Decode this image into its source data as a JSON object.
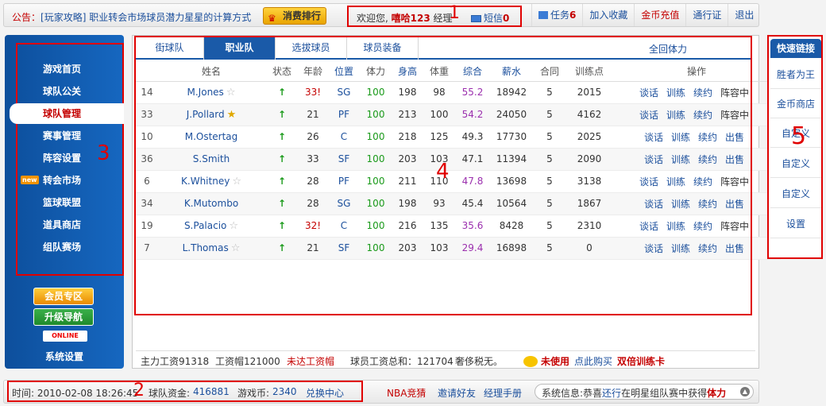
{
  "header": {
    "announce_prefix": "公告：",
    "announce_text": "[玩家攻略] 职业转会市场球员潜力星星的计算方式",
    "rank_button": "消费排行",
    "welcome_prefix": "欢迎您,",
    "username": "嘻哈123",
    "user_role": "经理",
    "mail_label": "短信",
    "mail_count": "0",
    "task_label": "任务",
    "task_count": "6",
    "favorite": "加入收藏",
    "gold_recharge": "金币充值",
    "passport": "通行证",
    "logout": "退出"
  },
  "markers": [
    "1",
    "2",
    "3",
    "4",
    "5"
  ],
  "sidebar": {
    "items": [
      {
        "label": "游戏首页"
      },
      {
        "label": "球队公关"
      },
      {
        "label": "球队管理"
      },
      {
        "label": "赛事管理"
      },
      {
        "label": "阵容设置"
      },
      {
        "label": "转会市场",
        "badge": "new"
      },
      {
        "label": "篮球联盟"
      },
      {
        "label": "道具商店"
      },
      {
        "label": "组队赛场"
      }
    ],
    "vip": "会员专区",
    "upgrade": "升级导航",
    "online": "ONLINE",
    "settings": "系统设置"
  },
  "tabs": [
    "街球队",
    "职业队",
    "选拔球员",
    "球员装备"
  ],
  "tab_right": "全回体力",
  "table": {
    "headers": [
      "姓名",
      "状态",
      "年龄",
      "位置",
      "体力",
      "身高",
      "体重",
      "综合",
      "薪水",
      "合同",
      "训练点",
      "操作"
    ],
    "rows": [
      {
        "num": "14",
        "name": "M.Jones",
        "age": "33!",
        "pos": "SG",
        "stamina": "100",
        "height": "198",
        "weight": "98",
        "overall": "55.2",
        "salary": "18942",
        "contract": "5",
        "train": "2015",
        "ops": [
          "谈话",
          "训练",
          "续约",
          "阵容中"
        ]
      },
      {
        "num": "33",
        "name": "J.Pollard",
        "age": "21",
        "pos": "PF",
        "stamina": "100",
        "height": "213",
        "weight": "100",
        "overall": "54.2",
        "salary": "24050",
        "contract": "5",
        "train": "4162",
        "ops": [
          "谈话",
          "训练",
          "续约",
          "阵容中"
        ]
      },
      {
        "num": "10",
        "name": "M.Ostertag",
        "age": "26",
        "pos": "C",
        "stamina": "100",
        "height": "218",
        "weight": "125",
        "overall": "49.3",
        "salary": "17730",
        "contract": "5",
        "train": "2025",
        "ops": [
          "谈话",
          "训练",
          "续约",
          "出售"
        ]
      },
      {
        "num": "36",
        "name": "S.Smith",
        "age": "33",
        "pos": "SF",
        "stamina": "100",
        "height": "203",
        "weight": "103",
        "overall": "47.1",
        "salary": "11394",
        "contract": "5",
        "train": "2090",
        "ops": [
          "谈话",
          "训练",
          "续约",
          "出售"
        ]
      },
      {
        "num": "6",
        "name": "K.Whitney",
        "age": "28",
        "pos": "PF",
        "stamina": "100",
        "height": "211",
        "weight": "110",
        "overall": "47.8",
        "salary": "13698",
        "contract": "5",
        "train": "3138",
        "ops": [
          "谈话",
          "训练",
          "续约",
          "阵容中"
        ]
      },
      {
        "num": "34",
        "name": "K.Mutombo",
        "age": "28",
        "pos": "SG",
        "stamina": "100",
        "height": "198",
        "weight": "93",
        "overall": "45.4",
        "salary": "10564",
        "contract": "5",
        "train": "1867",
        "ops": [
          "谈话",
          "训练",
          "续约",
          "出售"
        ]
      },
      {
        "num": "19",
        "name": "S.Palacio",
        "age": "32!",
        "pos": "C",
        "stamina": "100",
        "height": "216",
        "weight": "135",
        "overall": "35.6",
        "salary": "8428",
        "contract": "5",
        "train": "2310",
        "ops": [
          "谈话",
          "训练",
          "续约",
          "阵容中"
        ]
      },
      {
        "num": "7",
        "name": "L.Thomas",
        "age": "21",
        "pos": "SF",
        "stamina": "100",
        "height": "203",
        "weight": "103",
        "overall": "29.4",
        "salary": "16898",
        "contract": "5",
        "train": "0",
        "ops": [
          "谈话",
          "训练",
          "续约",
          "出售"
        ]
      }
    ]
  },
  "footer": {
    "main_salary": "主力工资91318",
    "salary_cap": "工资帽121000",
    "cap_status": "未达工资帽",
    "total_salary": "球员工资总和：121704",
    "luxury_tax": "奢侈税无。",
    "unused": "未使用",
    "buy_link": "点此购买",
    "card": "双倍训练卡"
  },
  "quick_links": {
    "title": "快速链接",
    "items": [
      "胜者为王",
      "金币商店",
      "自定义",
      "自定义",
      "自定义",
      "设置"
    ]
  },
  "bottom": {
    "time": "时间: 2010-02-08 18:26:45",
    "funds_label": "球队资金:",
    "funds": "416881",
    "coins_label": "游戏币:",
    "coins": "2340",
    "exchange": "兑换中心",
    "nba": "NBA竞猜",
    "invite": "邀请好友",
    "manual": "经理手册",
    "sys_prefix": "系统信息:恭喜",
    "sys_name": "还行",
    "sys_mid": "在明星组队赛中获得",
    "sys_reward": "体力"
  }
}
